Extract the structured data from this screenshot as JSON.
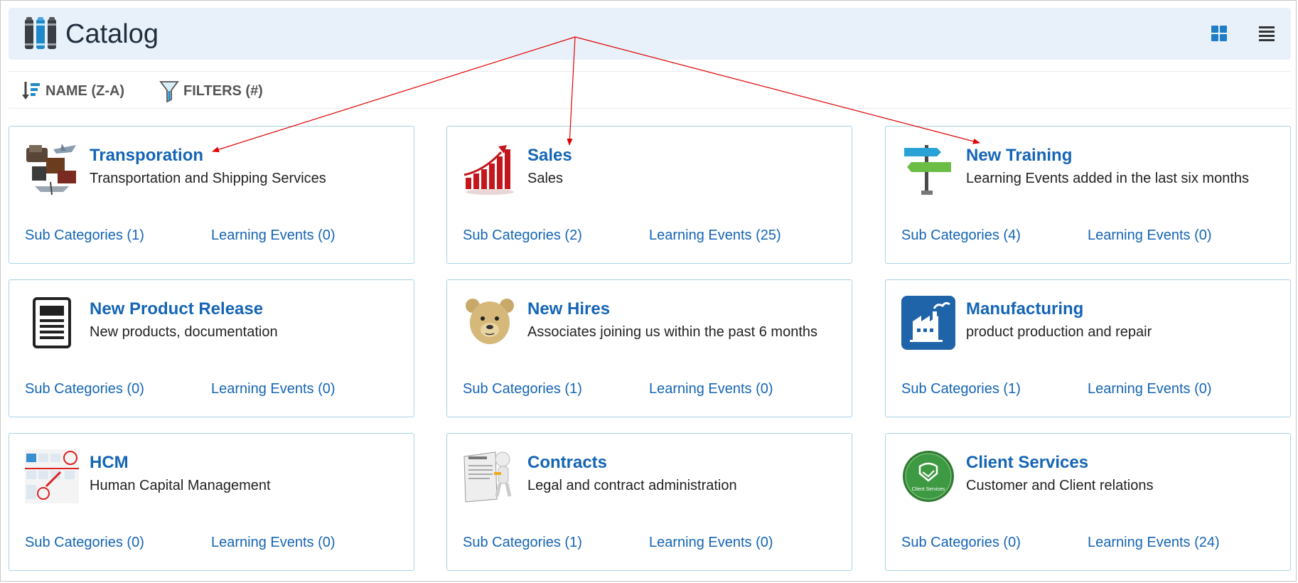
{
  "header": {
    "title": "Catalog"
  },
  "toolbar": {
    "sort_label": "NAME (Z-A)",
    "filters_label": "FILTERS (#)"
  },
  "colors": {
    "link": "#1565b5",
    "header_bg": "#e8f1fa",
    "card_border": "#a9d3e6",
    "annotation": "#e00000"
  },
  "cards": [
    {
      "title": "Transporation",
      "description": "Transportation and Shipping Services",
      "sub": "Sub Categories (1)",
      "events": "Learning Events (0)",
      "icon": "transport-collage-image"
    },
    {
      "title": "Sales",
      "description": "Sales",
      "sub": "Sub Categories (2)",
      "events": "Learning Events (25)",
      "icon": "sales-growth-chart-image"
    },
    {
      "title": "New Training",
      "description": "Learning Events added in the last six months",
      "sub": "Sub Categories (4)",
      "events": "Learning Events (0)",
      "icon": "training-signpost-image"
    },
    {
      "title": "New Product Release",
      "description": "New products, documentation",
      "sub": "Sub Categories (0)",
      "events": "Learning Events (0)",
      "icon": "document-icon"
    },
    {
      "title": "New Hires",
      "description": "Associates joining us within the past 6 months",
      "sub": "Sub Categories (1)",
      "events": "Learning Events (0)",
      "icon": "teddy-bear-image"
    },
    {
      "title": "Manufacturing",
      "description": "product production and repair",
      "sub": "Sub Categories (1)",
      "events": "Learning Events (0)",
      "icon": "factory-icon"
    },
    {
      "title": "HCM",
      "description": "Human Capital Management",
      "sub": "Sub Categories (0)",
      "events": "Learning Events (0)",
      "icon": "hcm-screenshot-image"
    },
    {
      "title": "Contracts",
      "description": "Legal and contract administration",
      "sub": "Sub Categories (1)",
      "events": "Learning Events (0)",
      "icon": "contract-figure-image"
    },
    {
      "title": "Client Services",
      "description": "Customer and Client relations",
      "sub": "Sub Categories (0)",
      "events": "Learning Events (24)",
      "icon": "handshake-badge-icon",
      "badge_text": "Client Services"
    }
  ]
}
